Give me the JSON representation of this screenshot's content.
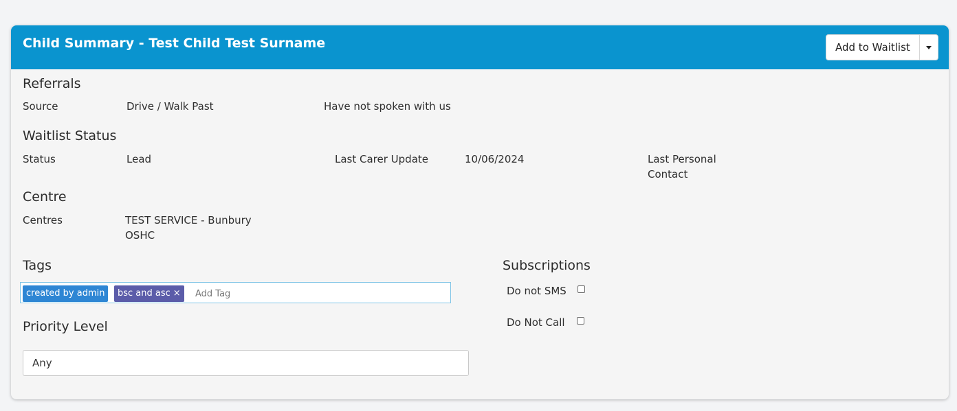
{
  "header": {
    "title": "Child Summary - Test Child Test Surname",
    "add_waitlist_label": "Add to Waitlist",
    "accent_color": "#0a94cf"
  },
  "referrals": {
    "heading": "Referrals",
    "source_label": "Source",
    "source_value": "Drive / Walk Past",
    "note": "Have not spoken with us"
  },
  "waitlist_status": {
    "heading": "Waitlist Status",
    "status_label": "Status",
    "status_value": "Lead",
    "last_carer_update_label": "Last Carer Update",
    "last_carer_update_value": "10/06/2024",
    "last_personal_contact_line1": "Last Personal",
    "last_personal_contact_line2": "Contact"
  },
  "centre": {
    "heading": "Centre",
    "centres_label": "Centres",
    "centres_value_line1": "TEST SERVICE - Bunbury",
    "centres_value_line2": "OSHC"
  },
  "tags": {
    "heading": "Tags",
    "items": [
      {
        "label": "created by admin",
        "color": "#2e86d4"
      },
      {
        "label": "bsc and asc",
        "color": "#5b5ca9"
      }
    ],
    "input_placeholder": "Add Tag"
  },
  "priority": {
    "heading": "Priority Level",
    "value": "Any"
  },
  "subscriptions": {
    "heading": "Subscriptions",
    "do_not_sms_label": "Do not SMS",
    "do_not_sms_checked": false,
    "do_not_call_label": "Do Not Call",
    "do_not_call_checked": false
  }
}
